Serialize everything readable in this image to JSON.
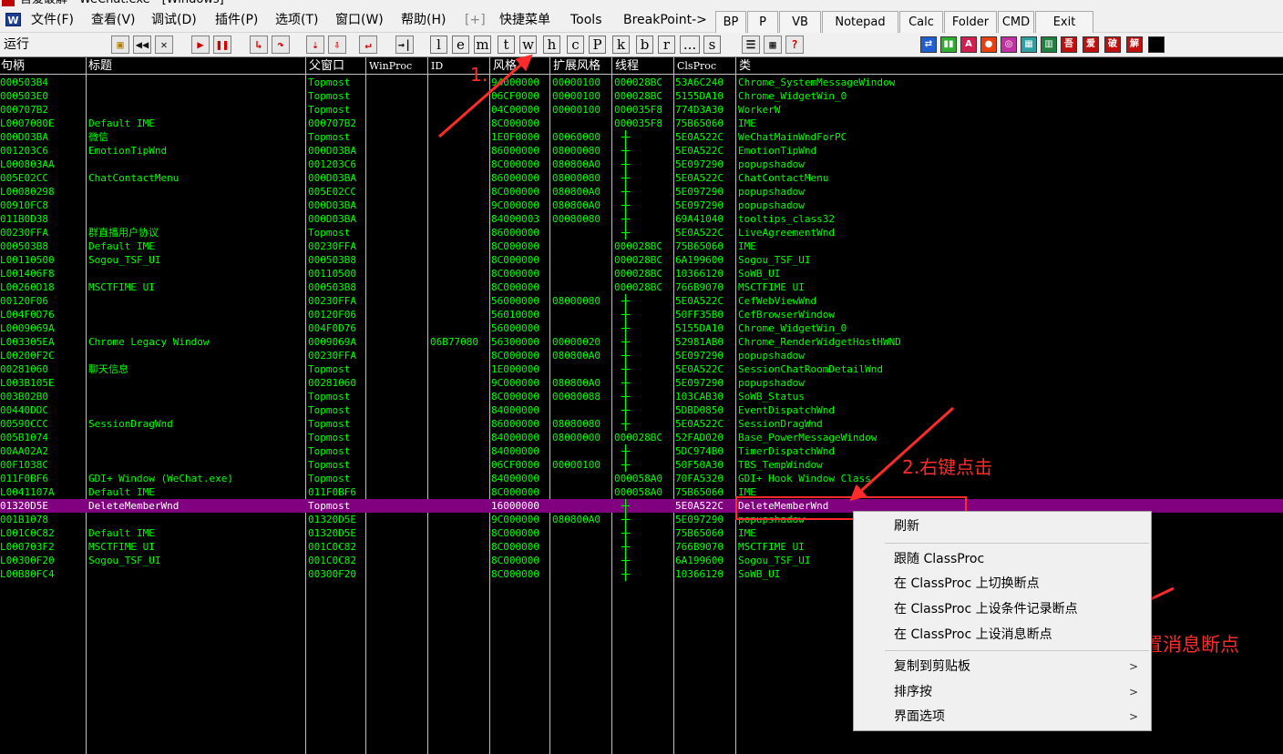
{
  "window": {
    "title": "吾爱破解 - WeChat.exe - [Windows]"
  },
  "menu": {
    "items": [
      "文件(F)",
      "查看(V)",
      "调试(D)",
      "插件(P)",
      "选项(T)",
      "窗口(W)",
      "帮助(H)",
      "[+]",
      "快捷菜单",
      "Tools",
      "BreakPoint->"
    ],
    "tool_buttons": [
      "BP",
      "P",
      "VB",
      "Notepad",
      "Calc",
      "Folder",
      "CMD",
      "Exit"
    ]
  },
  "toolbar": {
    "run_label": "运行",
    "letters": [
      "l",
      "e",
      "m",
      "t",
      "w",
      "h",
      "c",
      "P",
      "k",
      "b",
      "r",
      "...",
      "s"
    ],
    "plugin_icons": [
      "吾",
      "爱",
      "破",
      "解"
    ]
  },
  "grid": {
    "columns": [
      "句柄",
      "标题",
      "父窗口",
      "WinProc",
      "ID",
      "风格",
      "扩展风格",
      "线程",
      "ClsProc",
      "类"
    ],
    "rows": [
      {
        "handle": "000503B4",
        "title": "",
        "parent": "Topmost",
        "winproc": "",
        "id": "",
        "style": "94000000",
        "exstyle": "00000100",
        "thread": "000028BC",
        "clsproc": "53A6C240",
        "cls": "Chrome_SystemMessageWindow"
      },
      {
        "handle": "000503E0",
        "title": "",
        "parent": "Topmost",
        "winproc": "",
        "id": "",
        "style": "06CF0000",
        "exstyle": "00000100",
        "thread": "000028BC",
        "clsproc": "5155DA10",
        "cls": "Chrome_WidgetWin_0"
      },
      {
        "handle": "000707B2",
        "title": "",
        "parent": "Topmost",
        "winproc": "",
        "id": "",
        "style": "04C00000",
        "exstyle": "00000100",
        "thread": "000035F8",
        "clsproc": "774D3A30",
        "cls": "WorkerW"
      },
      {
        "handle": "L0007080E",
        "title": "Default IME",
        "parent": "000707B2",
        "winproc": "",
        "id": "",
        "style": "8C000000",
        "exstyle": "",
        "thread": "000035F8",
        "clsproc": "75B65060",
        "cls": "IME"
      },
      {
        "handle": "000D03BA",
        "title": "微信",
        "parent": "Topmost",
        "winproc": "",
        "id": "",
        "style": "1E0F0000",
        "exstyle": "00060000",
        "thread": "",
        "clsproc": "5E0A522C",
        "cls": "WeChatMainWndForPC"
      },
      {
        "handle": "001203C6",
        "title": "EmotionTipWnd",
        "parent": "000D03BA",
        "winproc": "",
        "id": "",
        "style": "86000000",
        "exstyle": "08000080",
        "thread": "",
        "clsproc": "5E0A522C",
        "cls": "EmotionTipWnd"
      },
      {
        "handle": "L000803AA",
        "title": "",
        "parent": "001203C6",
        "winproc": "",
        "id": "",
        "style": "8C000000",
        "exstyle": "080800A0",
        "thread": "",
        "clsproc": "5E097290",
        "cls": "popupshadow"
      },
      {
        "handle": "005E02CC",
        "title": "ChatContactMenu",
        "parent": "000D03BA",
        "winproc": "",
        "id": "",
        "style": "86000000",
        "exstyle": "08000080",
        "thread": "",
        "clsproc": "5E0A522C",
        "cls": "ChatContactMenu"
      },
      {
        "handle": "L00080298",
        "title": "",
        "parent": "005E02CC",
        "winproc": "",
        "id": "",
        "style": "8C000000",
        "exstyle": "080800A0",
        "thread": "",
        "clsproc": "5E097290",
        "cls": "popupshadow"
      },
      {
        "handle": "00910FC8",
        "title": "",
        "parent": "000D03BA",
        "winproc": "",
        "id": "",
        "style": "9C000000",
        "exstyle": "080800A0",
        "thread": "",
        "clsproc": "5E097290",
        "cls": "popupshadow"
      },
      {
        "handle": "011B0D38",
        "title": "",
        "parent": "000D03BA",
        "winproc": "",
        "id": "",
        "style": "84000003",
        "exstyle": "00080080",
        "thread": "",
        "clsproc": "69A41040",
        "cls": "tooltips_class32"
      },
      {
        "handle": "00230FFA",
        "title": "群直播用户协议",
        "parent": "Topmost",
        "winproc": "",
        "id": "",
        "style": "86000000",
        "exstyle": "",
        "thread": "",
        "clsproc": "5E0A522C",
        "cls": "LiveAgreementWnd"
      },
      {
        "handle": "000503B8",
        "title": "Default IME",
        "parent": "00230FFA",
        "winproc": "",
        "id": "",
        "style": "8C000000",
        "exstyle": "",
        "thread": "000028BC",
        "clsproc": "75B65060",
        "cls": "IME"
      },
      {
        "handle": "L00110500",
        "title": "Sogou_TSF_UI",
        "parent": "000503B8",
        "winproc": "",
        "id": "",
        "style": "8C000000",
        "exstyle": "",
        "thread": "000028BC",
        "clsproc": "6A199600",
        "cls": "Sogou_TSF_UI"
      },
      {
        "handle": "L001406F8",
        "title": "",
        "parent": "00110500",
        "winproc": "",
        "id": "",
        "style": "8C000000",
        "exstyle": "",
        "thread": "000028BC",
        "clsproc": "10366120",
        "cls": "SoWB_UI"
      },
      {
        "handle": "L00260D18",
        "title": "MSCTFIME UI",
        "parent": "000503B8",
        "winproc": "",
        "id": "",
        "style": "8C000000",
        "exstyle": "",
        "thread": "000028BC",
        "clsproc": "766B9070",
        "cls": "MSCTFIME UI"
      },
      {
        "handle": "00120F06",
        "title": "",
        "parent": "00230FFA",
        "winproc": "",
        "id": "",
        "style": "56000000",
        "exstyle": "08000080",
        "thread": "",
        "clsproc": "5E0A522C",
        "cls": "CefWebViewWnd"
      },
      {
        "handle": "L004F0D76",
        "title": "",
        "parent": "00120F06",
        "winproc": "",
        "id": "",
        "style": "56010000",
        "exstyle": "",
        "thread": "",
        "clsproc": "50FF35B0",
        "cls": "CefBrowserWindow"
      },
      {
        "handle": "L0009069A",
        "title": "",
        "parent": "004F0D76",
        "winproc": "",
        "id": "",
        "style": "56000000",
        "exstyle": "",
        "thread": "",
        "clsproc": "5155DA10",
        "cls": "Chrome_WidgetWin_0"
      },
      {
        "handle": "L003305EA",
        "title": "Chrome Legacy Window",
        "parent": "0009069A",
        "winproc": "",
        "id": "06B77080",
        "style": "56300000",
        "exstyle": "00000020",
        "thread": "",
        "clsproc": "52981AB0",
        "cls": "Chrome_RenderWidgetHostHWND"
      },
      {
        "handle": "L00200F2C",
        "title": "",
        "parent": "00230FFA",
        "winproc": "",
        "id": "",
        "style": "8C000000",
        "exstyle": "080800A0",
        "thread": "",
        "clsproc": "5E097290",
        "cls": "popupshadow"
      },
      {
        "handle": "00281060",
        "title": "聊天信息",
        "parent": "Topmost",
        "winproc": "",
        "id": "",
        "style": "1E000000",
        "exstyle": "",
        "thread": "",
        "clsproc": "5E0A522C",
        "cls": "SessionChatRoomDetailWnd"
      },
      {
        "handle": "L003B105E",
        "title": "",
        "parent": "00281060",
        "winproc": "",
        "id": "",
        "style": "9C000000",
        "exstyle": "080800A0",
        "thread": "",
        "clsproc": "5E097290",
        "cls": "popupshadow"
      },
      {
        "handle": "003B02B0",
        "title": "",
        "parent": "Topmost",
        "winproc": "",
        "id": "",
        "style": "8C000000",
        "exstyle": "00080088",
        "thread": "",
        "clsproc": "103CAB30",
        "cls": "SoWB_Status"
      },
      {
        "handle": "00440DDC",
        "title": "",
        "parent": "Topmost",
        "winproc": "",
        "id": "",
        "style": "84000000",
        "exstyle": "",
        "thread": "",
        "clsproc": "5DBD0850",
        "cls": "EventDispatchWnd"
      },
      {
        "handle": "00590CCC",
        "title": "SessionDragWnd",
        "parent": "Topmost",
        "winproc": "",
        "id": "",
        "style": "86000000",
        "exstyle": "08080080",
        "thread": "",
        "clsproc": "5E0A522C",
        "cls": "SessionDragWnd"
      },
      {
        "handle": "005B1074",
        "title": "",
        "parent": "Topmost",
        "winproc": "",
        "id": "",
        "style": "84000000",
        "exstyle": "08000000",
        "thread": "000028BC",
        "clsproc": "52FAD020",
        "cls": "Base_PowerMessageWindow"
      },
      {
        "handle": "00AA02A2",
        "title": "",
        "parent": "Topmost",
        "winproc": "",
        "id": "",
        "style": "84000000",
        "exstyle": "",
        "thread": "",
        "clsproc": "5DC974B0",
        "cls": "TimerDispatchWnd"
      },
      {
        "handle": "00F1038C",
        "title": "",
        "parent": "Topmost",
        "winproc": "",
        "id": "",
        "style": "06CF0000",
        "exstyle": "00000100",
        "thread": "",
        "clsproc": "50F50A30",
        "cls": "TBS_TempWindow"
      },
      {
        "handle": "011F0BF6",
        "title": "GDI+ Window (WeChat.exe)",
        "parent": "Topmost",
        "winproc": "",
        "id": "",
        "style": "84000000",
        "exstyle": "",
        "thread": "000058A0",
        "clsproc": "70FA5320",
        "cls": "GDI+ Hook Window Class"
      },
      {
        "handle": "L0041107A",
        "title": "Default IME",
        "parent": "011F0BF6",
        "winproc": "",
        "id": "",
        "style": "8C000000",
        "exstyle": "",
        "thread": "000058A0",
        "clsproc": "75B65060",
        "cls": "IME"
      },
      {
        "handle": "01320D5E",
        "title": "DeleteMemberWnd",
        "parent": "Topmost",
        "winproc": "",
        "id": "",
        "style": "16000000",
        "exstyle": "",
        "thread": "",
        "clsproc": "5E0A522C",
        "cls": "DeleteMemberWnd"
      },
      {
        "handle": "001B1078",
        "title": "",
        "parent": "01320D5E",
        "winproc": "",
        "id": "",
        "style": "9C000000",
        "exstyle": "080800A0",
        "thread": "",
        "clsproc": "5E097290",
        "cls": "popupshadow"
      },
      {
        "handle": "L001C0C82",
        "title": "Default IME",
        "parent": "01320D5E",
        "winproc": "",
        "id": "",
        "style": "8C000000",
        "exstyle": "",
        "thread": "",
        "clsproc": "75B65060",
        "cls": "IME"
      },
      {
        "handle": "L000703F2",
        "title": "MSCTFIME UI",
        "parent": "001C0C82",
        "winproc": "",
        "id": "",
        "style": "8C000000",
        "exstyle": "",
        "thread": "",
        "clsproc": "766B9070",
        "cls": "MSCTFIME UI"
      },
      {
        "handle": "L00300F20",
        "title": "Sogou_TSF_UI",
        "parent": "001C0C82",
        "winproc": "",
        "id": "",
        "style": "8C000000",
        "exstyle": "",
        "thread": "",
        "clsproc": "6A199600",
        "cls": "Sogou_TSF_UI"
      },
      {
        "handle": "L00B80FC4",
        "title": "",
        "parent": "00300F20",
        "winproc": "",
        "id": "",
        "style": "8C000000",
        "exstyle": "",
        "thread": "",
        "clsproc": "10366120",
        "cls": "SoWB_UI"
      }
    ],
    "selected_row": 31
  },
  "context_menu": {
    "items": [
      {
        "label": "刷新",
        "submenu": false
      },
      {
        "label": "跟随 ClassProc",
        "submenu": false
      },
      {
        "label": "在 ClassProc 上切换断点",
        "submenu": false
      },
      {
        "label": "在 ClassProc 上设条件记录断点",
        "submenu": false
      },
      {
        "label": "在 ClassProc 上设消息断点",
        "submenu": false
      },
      {
        "label": "复制到剪贴板",
        "submenu": true
      },
      {
        "label": "排序按",
        "submenu": true
      },
      {
        "label": "界面选项",
        "submenu": true
      }
    ]
  },
  "annotations": {
    "step1": "1.",
    "step2": "2.右键点击",
    "step3": "3.设置消息断点",
    "color": "#ff2a2a"
  },
  "colors": {
    "grid_text": "#00ff00",
    "grid_bg": "#000000",
    "selected_row": "#800080"
  }
}
